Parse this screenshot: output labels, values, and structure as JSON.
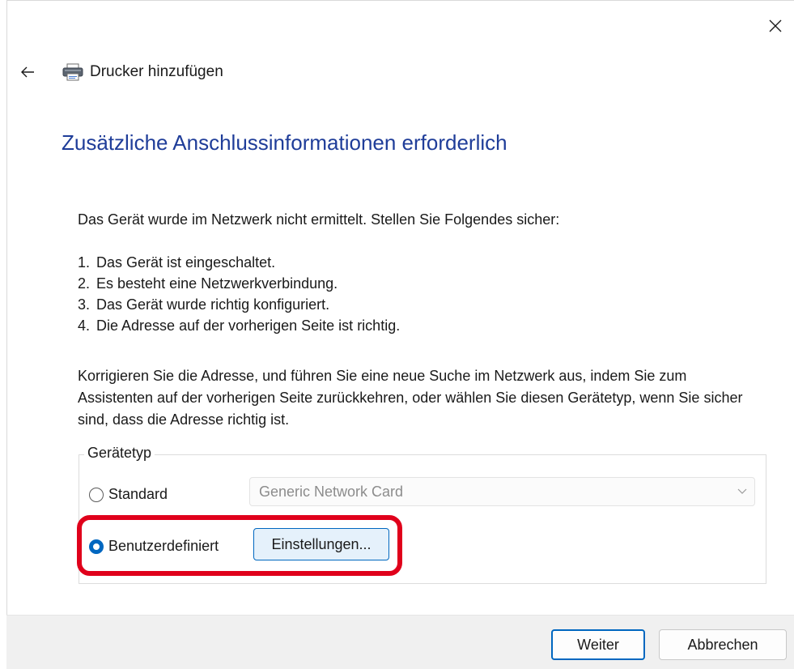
{
  "window": {
    "title": "Drucker hinzufügen"
  },
  "page": {
    "heading": "Zusätzliche Anschlussinformationen erforderlich",
    "intro": "Das Gerät wurde im Netzwerk nicht ermittelt. Stellen Sie Folgendes sicher:",
    "checklist": [
      {
        "num": "1.",
        "text": "Das Gerät ist eingeschaltet."
      },
      {
        "num": "2.",
        "text": "Es besteht eine Netzwerkverbindung."
      },
      {
        "num": "3.",
        "text": "Das Gerät wurde richtig konfiguriert."
      },
      {
        "num": "4.",
        "text": "Die Adresse auf der vorherigen Seite ist richtig."
      }
    ],
    "note": "Korrigieren Sie die Adresse, und führen Sie eine neue Suche im Netzwerk aus, indem Sie zum Assistenten auf der vorherigen Seite zurückkehren, oder wählen Sie diesen Gerätetyp, wenn Sie sicher sind, dass die Adresse richtig ist."
  },
  "device_type": {
    "legend": "Gerätetyp",
    "standard_label": "Standard",
    "standard_selected": false,
    "standard_dropdown_value": "Generic Network Card",
    "custom_label": "Benutzerdefiniert",
    "custom_selected": true,
    "settings_button": "Einstellungen..."
  },
  "footer": {
    "next_label": "Weiter",
    "cancel_label": "Abbrechen"
  },
  "colors": {
    "heading": "#1f3d99",
    "accent": "#0067c0",
    "highlight": "#e0001b"
  },
  "icons": {
    "close": "close-icon",
    "back": "back-arrow-icon",
    "printer": "printer-icon",
    "chevron": "chevron-down-icon"
  }
}
